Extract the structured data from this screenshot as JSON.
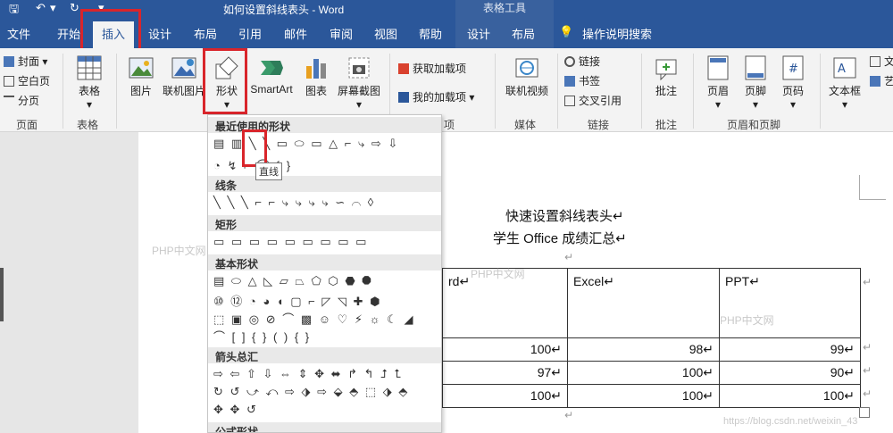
{
  "titlebar": {
    "title": "如何设置斜线表头 - Word",
    "context_tab_group": "表格工具"
  },
  "tabs": [
    "文件",
    "开始",
    "插入",
    "设计",
    "布局",
    "引用",
    "邮件",
    "审阅",
    "视图",
    "帮助",
    "设计",
    "布局"
  ],
  "tell_me": "操作说明搜索",
  "ribbon": {
    "pages": {
      "cover": "封面",
      "blank": "空白页",
      "break": "分页",
      "label": "页面"
    },
    "tables": {
      "table": "表格",
      "label": "表格"
    },
    "illus": {
      "picture": "图片",
      "online_picture": "联机图片",
      "shapes": "形状",
      "smartart": "SmartArt",
      "chart": "图表",
      "screenshot": "屏幕截图"
    },
    "addins": {
      "get": "获取加载项",
      "mine": "我的加载项",
      "label": "项"
    },
    "media": {
      "video": "联机视频",
      "label": "媒体"
    },
    "links": {
      "link": "链接",
      "bookmark": "书签",
      "cross": "交叉引用",
      "label": "链接"
    },
    "comments": {
      "comment": "批注",
      "label": "批注"
    },
    "hf": {
      "header": "页眉",
      "footer": "页脚",
      "pagenum": "页码",
      "label": "页眉和页脚"
    },
    "text": {
      "textbox": "文本框",
      "t1": "文",
      "t2": "艺"
    }
  },
  "shapes_menu": {
    "recent": "最近使用的形状",
    "lines": "线条",
    "rect": "矩形",
    "basic": "基本形状",
    "arrows": "箭头总汇",
    "formula": "公式形状",
    "tooltip": "直线",
    "row_recent1": "▤ ▥ ╲ ╲ ▭ ⬭ ▭ △ ⌐ ⤷ ⇨ ⇩",
    "row_recent2": "◔ ↯ ⌐ ⌒ { }",
    "row_lines": "╲ ╲ ╲ ⌐ ⌐ ⤷ ⤷ ⤷ ⤷ ∽ ⌒ ◊",
    "row_rect": "▭ ▭ ▭ ▭ ▭ ▭ ▭ ▭ ▭",
    "row_basic1": "▤ ⬭ △ ◺ ▱ ⏢ ⬠ ⬡ ⬣ ⯃",
    "row_basic2": "⑩ ⑫ ◔ ◕ ◖ ▢ ⌐ ◸ ◹ ✚ ⬢",
    "row_basic3": "⬚ ▣ ◎ ⊘ ⌒ ▩ ☺ ♡ ⚡ ☼ ☾ ◢",
    "row_basic4": "⌒ [ ] { } ( ) { }",
    "row_arrows1": "⇨ ⇦ ⇧ ⇩ ⇔ ⇕ ✥ ⬌ ↱ ↰ ⮥ ⮤",
    "row_arrows2": "↻ ↺ ⤻ ⤺ ⇨ ⬗ ⇨ ⬙ ⬘ ⬚ ⬗ ⬘",
    "row_arrows3": "✥ ✥ ↺"
  },
  "document": {
    "title1": "快速设置斜线表头↵",
    "title2": "学生 Office 成绩汇总↵",
    "para_mark": "↵",
    "headers": [
      "rd↵",
      "Excel↵",
      "PPT↵"
    ],
    "rows": [
      [
        "100↵",
        "98↵",
        "99↵"
      ],
      [
        "97↵",
        "100↵",
        "90↵"
      ],
      [
        "100↵",
        "100↵",
        "100↵"
      ]
    ]
  },
  "watermarks": {
    "php": "PHP中文网",
    "url": "https://blog.csdn.net/weixin_43"
  }
}
